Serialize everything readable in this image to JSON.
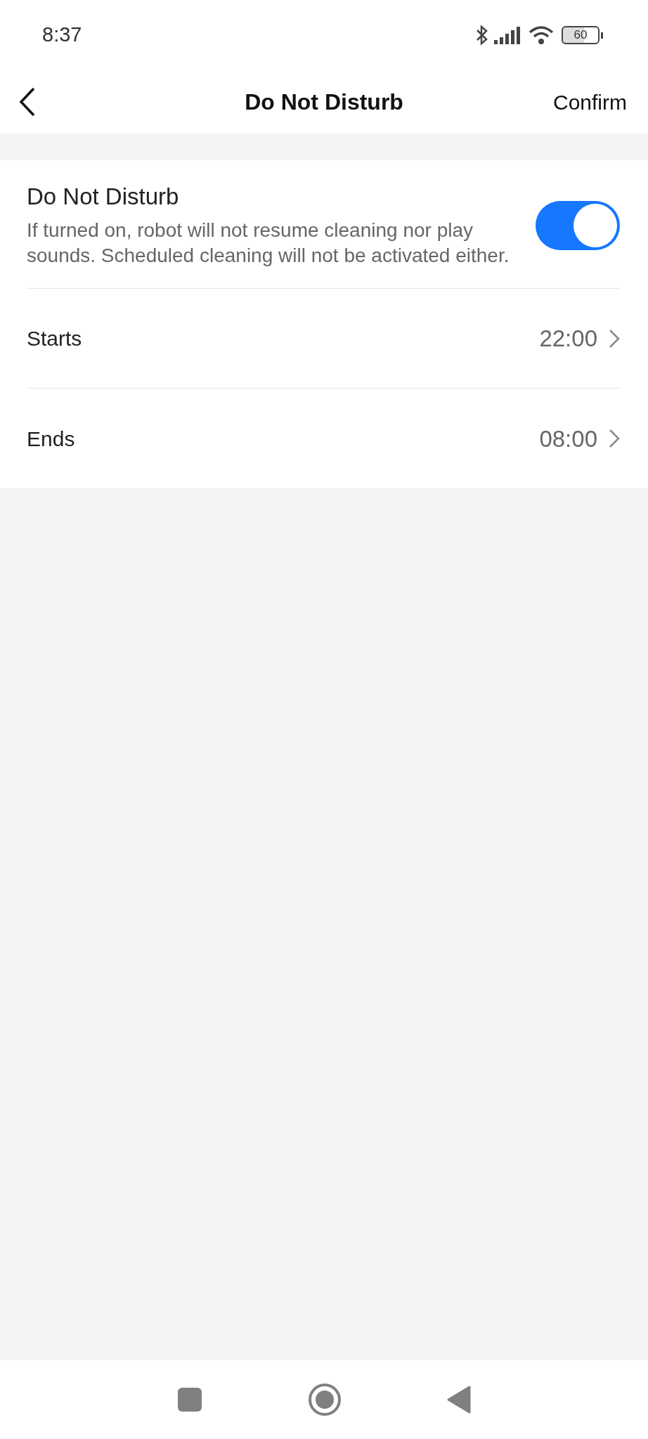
{
  "status_bar": {
    "time": "8:37",
    "battery": "60"
  },
  "header": {
    "title": "Do Not Disturb",
    "action": "Confirm"
  },
  "toggle": {
    "title": "Do Not Disturb",
    "description": "If turned on, robot will not resume cleaning nor play sounds. Scheduled cleaning will not be activated either.",
    "on": true
  },
  "rows": [
    {
      "label": "Starts",
      "value": "22:00"
    },
    {
      "label": "Ends",
      "value": "08:00"
    }
  ]
}
